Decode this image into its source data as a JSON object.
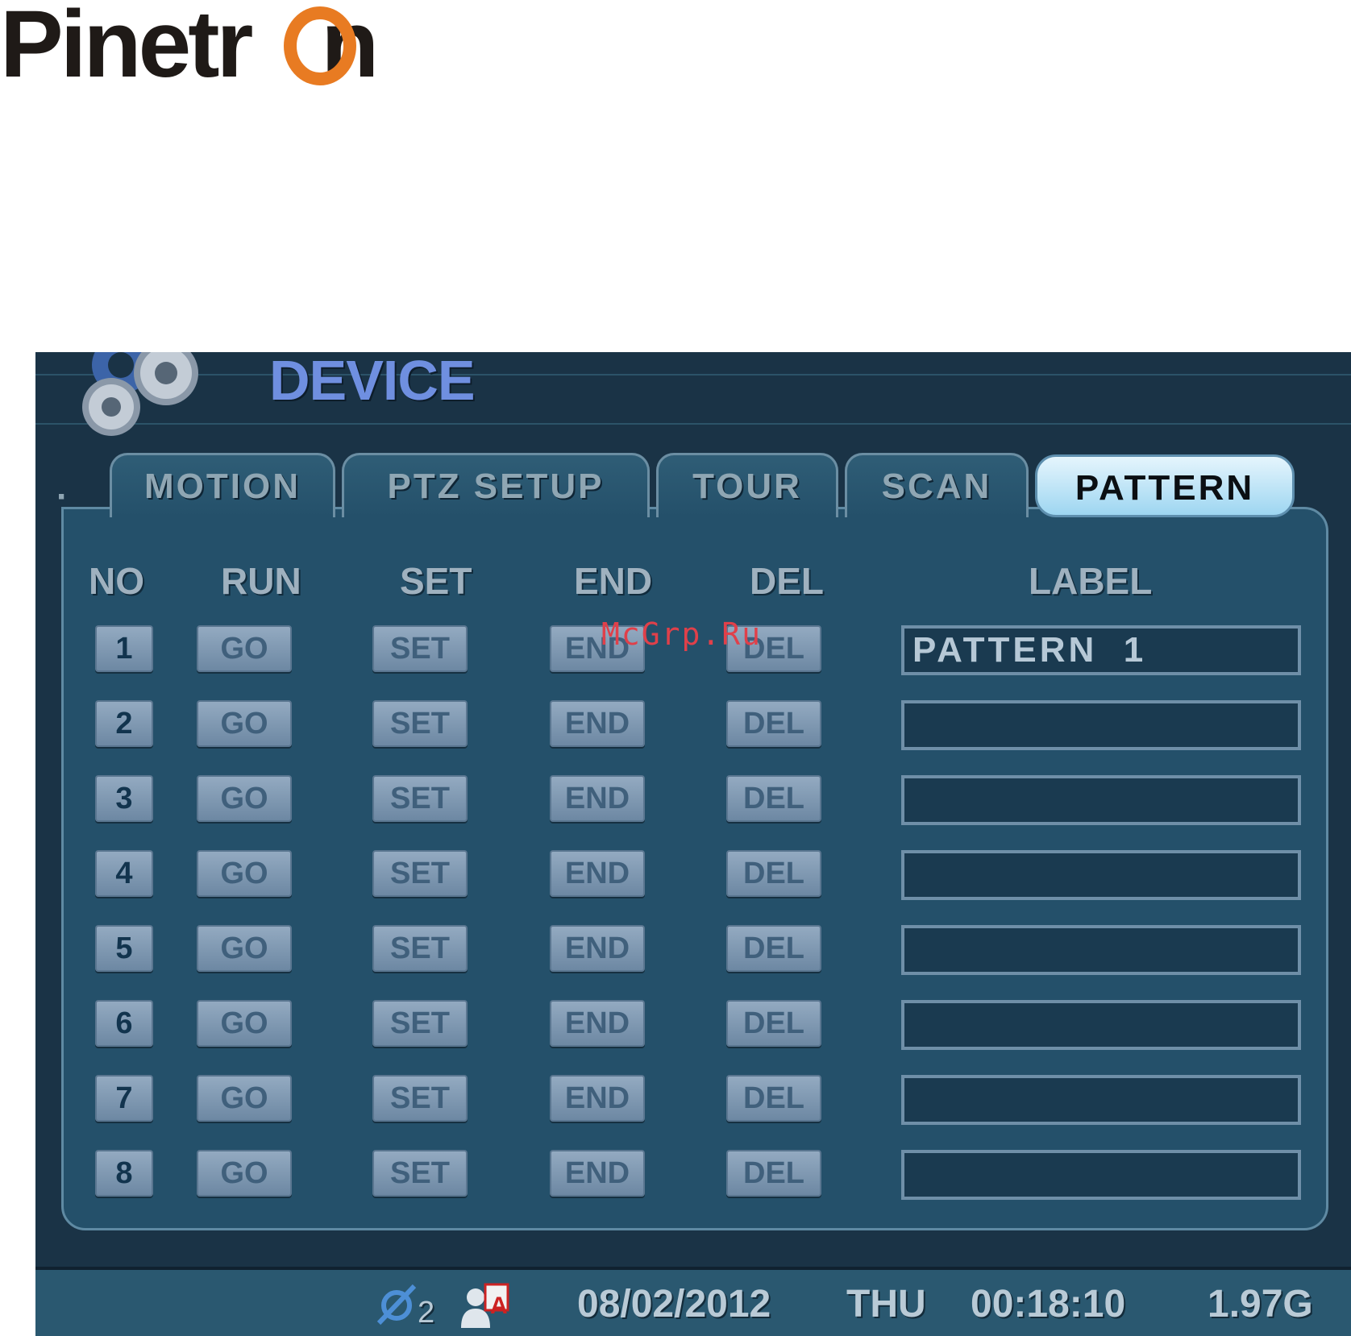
{
  "logo": {
    "text_pre": "Pinetr",
    "text_ring": "O",
    "text_post": "n",
    "ring_color": "#e87b22",
    "text_color": "#1f1a17"
  },
  "header": {
    "title": "DEVICE",
    "icon": "gears-icon"
  },
  "tabs": [
    {
      "label": "MOTION",
      "active": false
    },
    {
      "label": "PTZ SETUP",
      "active": false
    },
    {
      "label": "TOUR",
      "active": false
    },
    {
      "label": "SCAN",
      "active": false
    },
    {
      "label": "PATTERN",
      "active": true
    }
  ],
  "columns": {
    "no": "NO",
    "run": "RUN",
    "set": "SET",
    "end": "END",
    "del": "DEL",
    "label": "LABEL"
  },
  "rows": [
    {
      "no": "1",
      "go": "GO",
      "set": "SET",
      "end": "END",
      "del": "DEL",
      "label": "PATTERN  1"
    },
    {
      "no": "2",
      "go": "GO",
      "set": "SET",
      "end": "END",
      "del": "DEL",
      "label": ""
    },
    {
      "no": "3",
      "go": "GO",
      "set": "SET",
      "end": "END",
      "del": "DEL",
      "label": ""
    },
    {
      "no": "4",
      "go": "GO",
      "set": "SET",
      "end": "END",
      "del": "DEL",
      "label": ""
    },
    {
      "no": "5",
      "go": "GO",
      "set": "SET",
      "end": "END",
      "del": "DEL",
      "label": ""
    },
    {
      "no": "6",
      "go": "GO",
      "set": "SET",
      "end": "END",
      "del": "DEL",
      "label": ""
    },
    {
      "no": "7",
      "go": "GO",
      "set": "SET",
      "end": "END",
      "del": "DEL",
      "label": ""
    },
    {
      "no": "8",
      "go": "GO",
      "set": "SET",
      "end": "END",
      "del": "DEL",
      "label": ""
    }
  ],
  "watermark": "McGrp.Ru",
  "status": {
    "network_icon": "network-icon",
    "network_count": "2",
    "user_icon": "user-admin-icon",
    "user_badge": "A",
    "date": "08/02/2012",
    "day": "THU",
    "time": "00:18:10",
    "storage": "1.97G"
  },
  "colors": {
    "screen_bg": "#1a3346",
    "panel_bg": "#24506a",
    "active_tab": "#bde6f8",
    "title": "#6f8fe0"
  }
}
